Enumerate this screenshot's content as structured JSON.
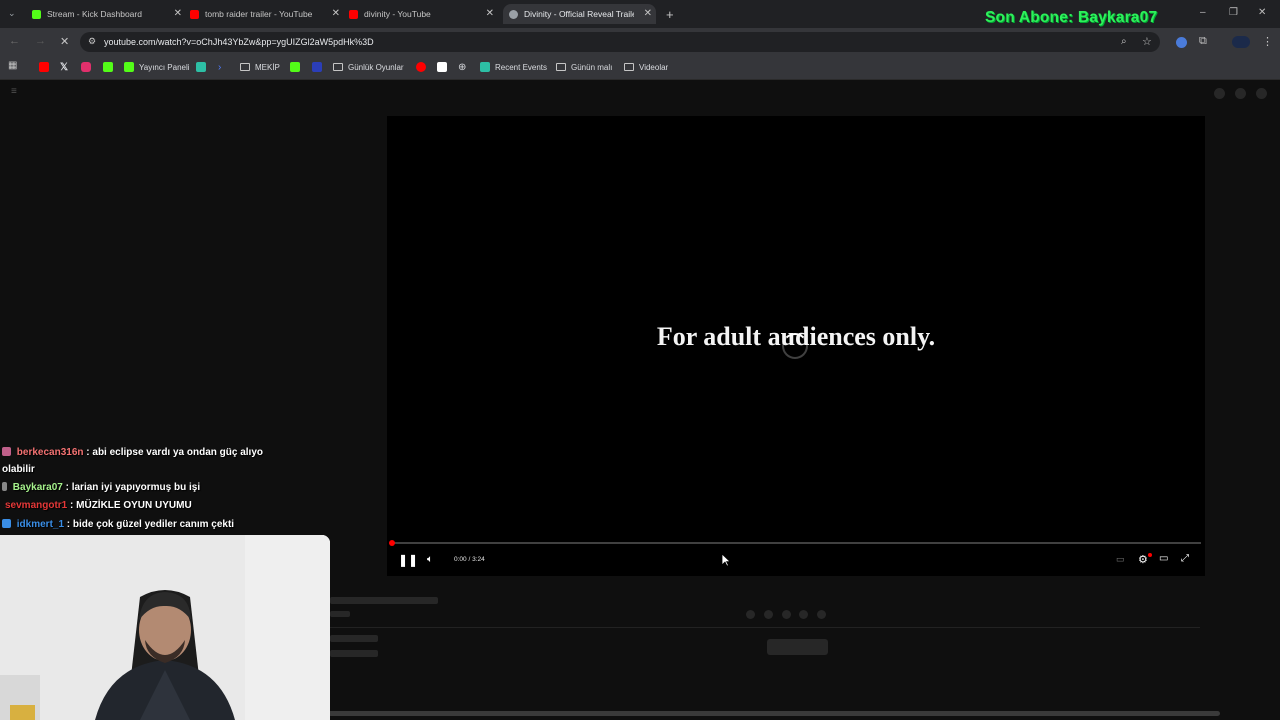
{
  "browser": {
    "tabs": [
      {
        "title": "Stream - Kick Dashboard",
        "favicon_color": "#53fc18"
      },
      {
        "title": "tomb raider trailer - YouTube",
        "favicon_color": "#ff0000"
      },
      {
        "title": "divinity - YouTube",
        "favicon_color": "#ff0000"
      },
      {
        "title": "Divinity - Official Reveal Trailer",
        "favicon_color": "#9aa0a6",
        "active": true
      }
    ],
    "new_tab": "+",
    "url": "youtube.com/watch?v=oChJh43YbZw&pp=ygUIZGl2aW5pdHk%3D",
    "window_controls": [
      "–",
      "❐",
      "✕"
    ]
  },
  "overlay": {
    "text": "Son Abone: Baykara07",
    "color": "#2ef05b"
  },
  "bookmarks": [
    {
      "label": "",
      "icon": "youtube-icon",
      "color": "#ff0000"
    },
    {
      "label": "",
      "icon": "x-icon",
      "color": "#ffffff"
    },
    {
      "label": "",
      "icon": "instagram-icon",
      "color": "#e1306c"
    },
    {
      "label": "",
      "icon": "kick-icon",
      "color": "#53fc18"
    },
    {
      "label": "Yayıncı Paneli",
      "icon": "kick-icon",
      "color": "#53fc18"
    },
    {
      "label": "",
      "icon": "app-icon",
      "color": "#2dbfa5"
    },
    {
      "label": "",
      "icon": "prompt-icon",
      "color": "#4f7cff"
    },
    {
      "label": "MEKİP",
      "icon": "folder-icon",
      "color": "#c5c5c5"
    },
    {
      "label": "",
      "icon": "kick-icon",
      "color": "#53fc18"
    },
    {
      "label": "",
      "icon": "blue-square-icon",
      "color": "#2b3eb8"
    },
    {
      "label": "Günlük Oyunlar",
      "icon": "folder-icon",
      "color": "#c5c5c5"
    },
    {
      "label": "",
      "icon": "youtube-icon",
      "color": "#ff0000"
    },
    {
      "label": "",
      "icon": "image-icon",
      "color": "#ffffff"
    },
    {
      "label": "",
      "icon": "globe-icon",
      "color": "#cfcfcf"
    },
    {
      "label": "Recent Events",
      "icon": "app-icon",
      "color": "#2dbfa5"
    },
    {
      "label": "Günün malı",
      "icon": "folder-icon",
      "color": "#c5c5c5"
    },
    {
      "label": "Videolar",
      "icon": "folder-icon",
      "color": "#c5c5c5"
    }
  ],
  "player": {
    "overlay_text": "For adult audiences only.",
    "time": "0:00 / 3:24",
    "progress": 0.0
  },
  "chat": [
    {
      "user": "berkecan316n",
      "user_color": "#f47272",
      "message": " : abi eclipse vardı ya ondan güç alıyo",
      "continued": "olabilir"
    },
    {
      "user": "Baykara07",
      "user_color": "#a6f28c",
      "message": " : larian iyi yapıyormuş bu işi"
    },
    {
      "user": "sevmangotr1",
      "user_color": "#e53838",
      "message": " : MÜZİKLE OYUN UYUMU"
    },
    {
      "user": "idkmert_1",
      "user_color": "#3a8ee6",
      "message": " : bide çok güzel yediler canım çekti"
    }
  ]
}
